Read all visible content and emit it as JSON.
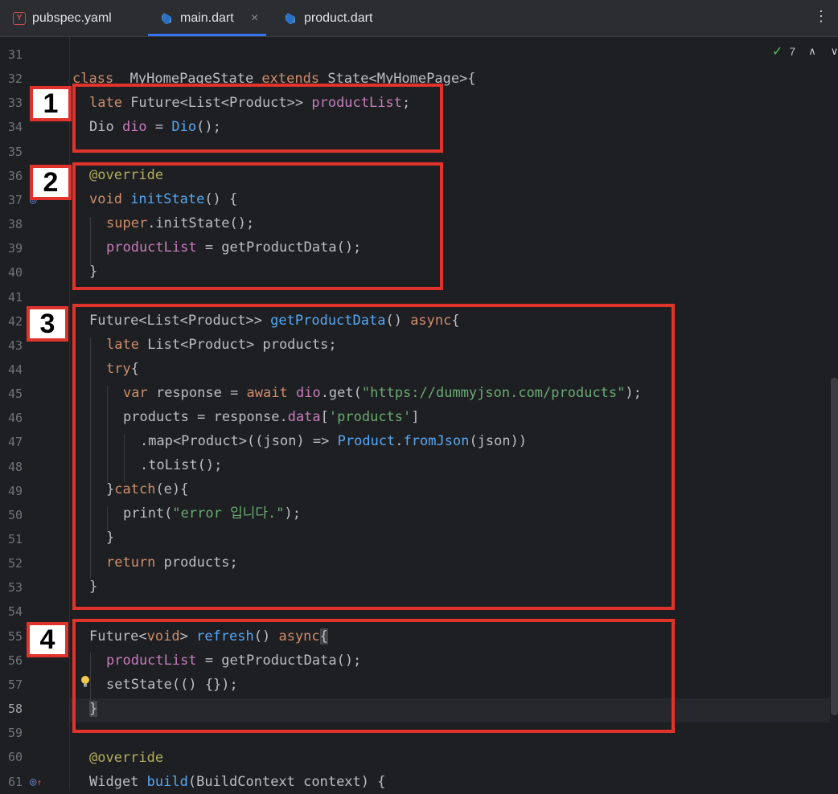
{
  "tabs": [
    {
      "label": "pubspec.yaml",
      "icon": "yaml-file-icon"
    },
    {
      "label": "main.dart",
      "icon": "dart-file-icon",
      "active": true
    },
    {
      "label": "product.dart",
      "icon": "dart-file-icon"
    }
  ],
  "inspection": {
    "count": "7"
  },
  "line_numbers": [
    "31",
    "32",
    "33",
    "34",
    "35",
    "36",
    "37",
    "38",
    "39",
    "40",
    "41",
    "42",
    "43",
    "44",
    "45",
    "46",
    "47",
    "48",
    "49",
    "50",
    "51",
    "52",
    "53",
    "54",
    "55",
    "56",
    "57",
    "58",
    "59",
    "60",
    "61"
  ],
  "annotations": [
    "1",
    "2",
    "3",
    "4"
  ],
  "code": {
    "l32": [
      "class ",
      "_MyHomePageState ",
      "extends ",
      "State<MyHomePage>{"
    ],
    "l33": [
      "late ",
      "Future<List<Product>> ",
      "productList",
      ";"
    ],
    "l34": [
      "Dio ",
      "dio",
      " = ",
      "Dio",
      "();"
    ],
    "l36": [
      "@override"
    ],
    "l37": [
      "void ",
      "initState",
      "() {"
    ],
    "l38": [
      "super",
      ".initState();"
    ],
    "l39": [
      "productList",
      " = getProductData();"
    ],
    "l40": [
      "}"
    ],
    "l42": [
      "Future<List<Product>> ",
      "getProductData",
      "() ",
      "async",
      "{"
    ],
    "l43": [
      "late ",
      "List<Product> products;"
    ],
    "l44": [
      "try",
      "{"
    ],
    "l45": [
      "var ",
      "response = ",
      "await ",
      "dio",
      ".get(",
      "\"https://dummyjson.com/products\"",
      ");"
    ],
    "l46": [
      "products = response.",
      "data",
      "[",
      "'products'",
      "]"
    ],
    "l47": [
      ".map<Product>((json) => ",
      "Product",
      ".",
      "fromJson",
      "(json))"
    ],
    "l48": [
      ".toList();"
    ],
    "l49": [
      "}",
      "catch",
      "(e){"
    ],
    "l50": [
      "print(",
      "\"error 입니다.\"",
      ");"
    ],
    "l51": [
      "}"
    ],
    "l52": [
      "return ",
      "products;"
    ],
    "l53": [
      "}"
    ],
    "l55": [
      "Future<",
      "void",
      "> ",
      "refresh",
      "() ",
      "async",
      "{"
    ],
    "l56": [
      "productList",
      " = getProductData();"
    ],
    "l57": [
      "setState(() {});"
    ],
    "l58": [
      "}"
    ],
    "l60": [
      "@override"
    ],
    "l61": [
      "Widget ",
      "build",
      "(BuildContext context) {"
    ]
  }
}
